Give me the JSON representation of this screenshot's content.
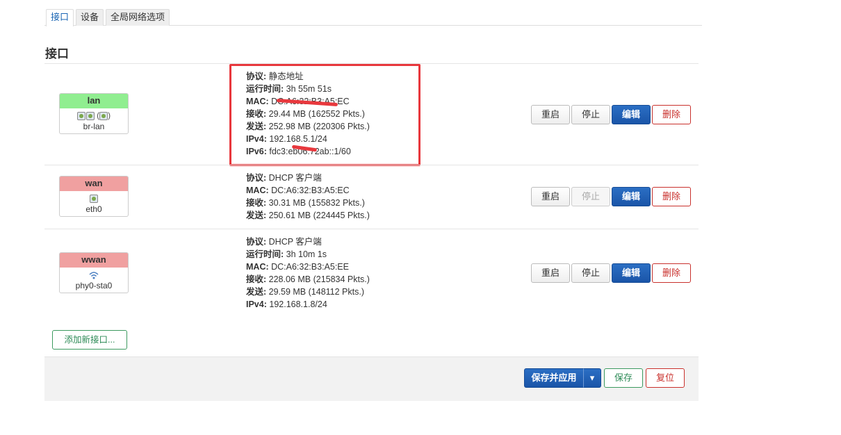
{
  "tabs": [
    {
      "label": "接口",
      "active": true
    },
    {
      "label": "设备",
      "active": false
    },
    {
      "label": "全局网络选项",
      "active": false
    }
  ],
  "section_title": "接口",
  "interfaces": [
    {
      "name": "lan",
      "header_color": "#90ee90",
      "device": "br-lan",
      "info": [
        {
          "k": "协议:",
          "v": " 静态地址"
        },
        {
          "k": "运行时间:",
          "v": " 3h 55m 51s"
        },
        {
          "k": "MAC:",
          "v": " DC:A6:32:B3:A5:EC"
        },
        {
          "k": "接收:",
          "v": " 29.44 MB (162552 Pkts.)"
        },
        {
          "k": "发送:",
          "v": " 252.98 MB (220306 Pkts.)"
        },
        {
          "k": "IPv4:",
          "v": " 192.168.5.1/24"
        },
        {
          "k": "IPv6:",
          "v": " fdc3:eb06:72ab::1/60"
        }
      ],
      "stop_disabled": false
    },
    {
      "name": "wan",
      "header_color": "#f0a0a0",
      "device": "eth0",
      "info": [
        {
          "k": "协议:",
          "v": " DHCP 客户端"
        },
        {
          "k": "MAC:",
          "v": " DC:A6:32:B3:A5:EC"
        },
        {
          "k": "接收:",
          "v": " 30.31 MB (155832 Pkts.)"
        },
        {
          "k": "发送:",
          "v": " 250.61 MB (224445 Pkts.)"
        }
      ],
      "stop_disabled": true
    },
    {
      "name": "wwan",
      "header_color": "#f0a0a0",
      "device": "phy0-sta0",
      "info": [
        {
          "k": "协议:",
          "v": " DHCP 客户端"
        },
        {
          "k": "运行时间:",
          "v": " 3h 10m 1s"
        },
        {
          "k": "MAC:",
          "v": " DC:A6:32:B3:A5:EE"
        },
        {
          "k": "接收:",
          "v": " 228.06 MB (215834 Pkts.)"
        },
        {
          "k": "发送:",
          "v": " 29.59 MB (148112 Pkts.)"
        },
        {
          "k": "IPv4:",
          "v": " 192.168.1.8/24"
        }
      ],
      "stop_disabled": false
    }
  ],
  "buttons": {
    "restart": "重启",
    "stop": "停止",
    "edit": "编辑",
    "delete": "删除",
    "add_interface": "添加新接口...",
    "save_apply": "保存并应用",
    "dropdown_caret": "▾",
    "save": "保存",
    "reset": "复位"
  },
  "colors": {
    "primary": "#1a55a8",
    "danger": "#c9302c",
    "success": "#2e8b57",
    "highlight": "#e8383d"
  }
}
